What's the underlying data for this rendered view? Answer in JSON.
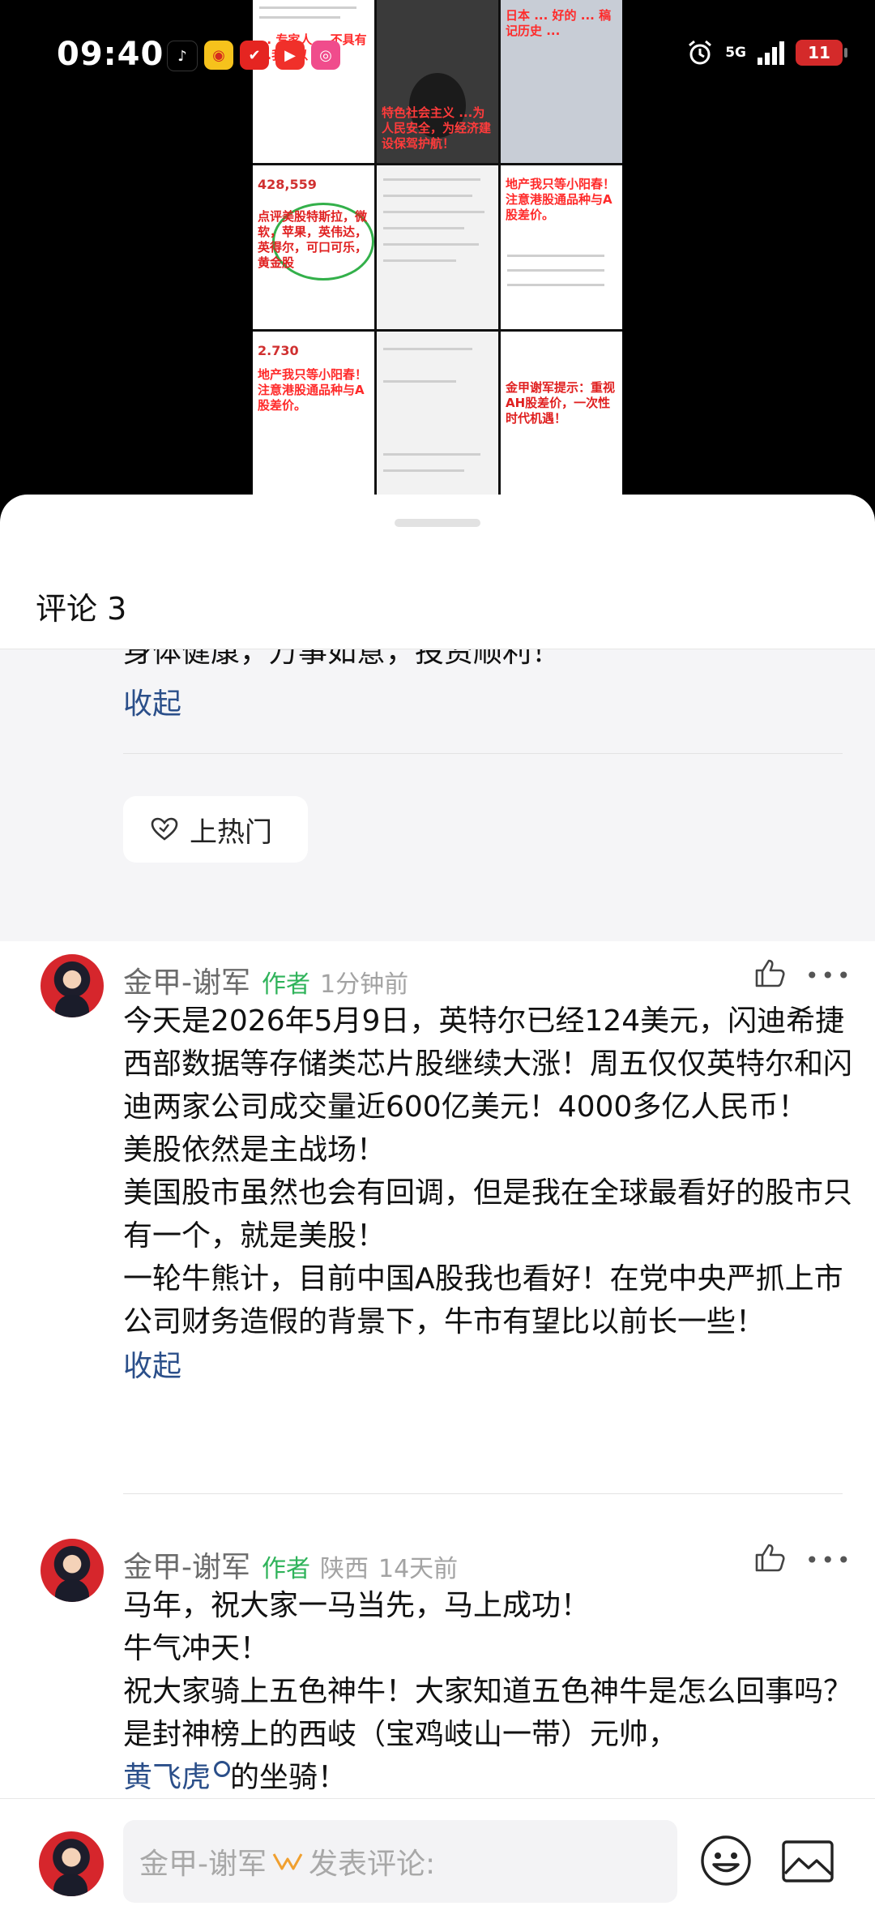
{
  "status_bar": {
    "time": "09:40",
    "network": "5G",
    "battery": "11",
    "app_icons": [
      "tiktok-icon",
      "weibo-icon",
      "red-app-icon",
      "video-app-icon",
      "pink-app-icon"
    ]
  },
  "background_video": {
    "tiles": [
      {
        "headline": "... 专家人 ...不具有 ...我是以 ..."
      },
      {
        "headline": "特色社会主义 ...为人民安全，为经济建设保驾护航！"
      },
      {
        "headline": "日本 ... 好的 ... 稿记历史 ..."
      },
      {
        "number": "428,559",
        "headline": "点评美股特斯拉，微软，苹果，英伟达，英得尔，可口可乐，黄金股"
      },
      {
        "headline": ""
      },
      {
        "headline": "地产我只等小阳春！注意港股通品种与A股差价。"
      },
      {
        "number": "2.730",
        "headline": "地产我只等小阳春！注意港股通品种与A股差价。"
      },
      {
        "headline": ""
      },
      {
        "headline": "金甲谢军提示：重视AH股差价，一次性时代机遇！"
      }
    ]
  },
  "sheet": {
    "title": "评论 3",
    "previous_comment_tail": "身体健康，万事如意，投资顺利！",
    "collapse_label": "收起",
    "hot_button_label": "上热门"
  },
  "comments": [
    {
      "username": "金甲-谢军",
      "author_tag": "作者",
      "location": "",
      "time": "1分钟前",
      "paragraphs": [
        "今天是2026年5月9日，英特尔已经124美元，闪迪希捷西部数据等存储类芯片股继续大涨！周五仅仅英特尔和闪迪两家公司成交量近600亿美元！4000多亿人民币！",
        "美股依然是主战场！",
        "美国股市虽然也会有回调，但是我在全球最看好的股市只有一个，就是美股！",
        "一轮牛熊计，目前中国A股我也看好！在党中央严抓上市公司财务造假的背景下，牛市有望比以前长一些！"
      ],
      "collapse_label": "收起"
    },
    {
      "username": "金甲-谢军",
      "author_tag": "作者",
      "location": "陕西",
      "time": "14天前",
      "paragraphs": [
        "马年，祝大家一马当先，马上成功！",
        "牛气冲天！",
        "祝大家骑上五色神牛！大家知道五色神牛是怎么回事吗？是封神榜上的西岐（宝鸡岐山一带）元帅，"
      ],
      "link_text": "黄飞虎",
      "after_link": "的坐骑！"
    }
  ],
  "bottom_bar": {
    "placeholder_name": "金甲-谢军",
    "placeholder_action": "发表评论:"
  }
}
